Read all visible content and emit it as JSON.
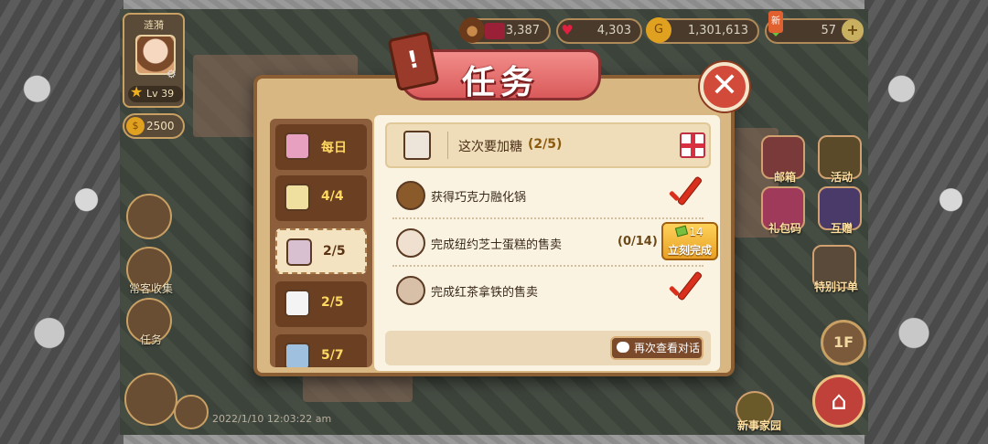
{
  "player": {
    "name": "涟漪",
    "level": "Lv 39",
    "gold": "2500"
  },
  "resources": {
    "coffee": "33,387",
    "hearts": "4,303",
    "coins": "1,301,613",
    "gems": "57",
    "gem_new_badge": "新"
  },
  "left_menu": {
    "quest_label": "任务",
    "collect_label": "常客收集"
  },
  "right_menu": {
    "mailbox": "邮箱",
    "activity": "活动",
    "gift_code": "礼包码",
    "gift": "互赠",
    "special_order": "特别订单",
    "new_store": "新事家园"
  },
  "floor_label": "1F",
  "timestamp": "2022/1/10 12:03:22 am",
  "dialog": {
    "title": "任务",
    "tabs": [
      {
        "label": "每日"
      },
      {
        "label": "4/4"
      },
      {
        "label": "2/5"
      },
      {
        "label": "2/5"
      },
      {
        "label": "5/7"
      }
    ],
    "active_tab_index": 2,
    "quest": {
      "title": "这次要加糖",
      "progress": "(2/5)"
    },
    "tasks": [
      {
        "text": "获得巧克力融化锅",
        "done": true
      },
      {
        "text": "完成纽约芝士蛋糕的售卖",
        "count": "(0/14)",
        "done": false,
        "cost": "14",
        "complete_label": "立刻完成"
      },
      {
        "text": "完成红茶拿铁的售卖",
        "done": true
      }
    ],
    "replay_label": "再次查看对话"
  },
  "colors": {
    "accent": "#d24a3a",
    "panel": "#d9b783",
    "check": "#d8301c",
    "complete_button": "#f0b030"
  }
}
